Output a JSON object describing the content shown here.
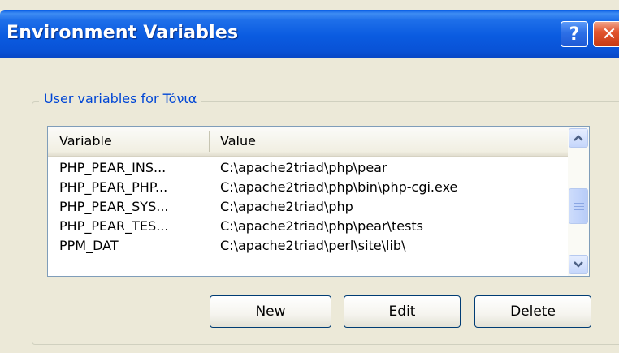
{
  "window": {
    "title": "Environment Variables",
    "help_label": "?",
    "close_label": "✕"
  },
  "user_variables": {
    "group_label": "User variables for Tóνια",
    "columns": [
      "Variable",
      "Value"
    ],
    "rows": [
      {
        "variable": "PHP_PEAR_INS...",
        "value": "C:\\apache2triad\\php\\pear"
      },
      {
        "variable": "PHP_PEAR_PHP...",
        "value": "C:\\apache2triad\\php\\bin\\php-cgi.exe"
      },
      {
        "variable": "PHP_PEAR_SYS...",
        "value": "C:\\apache2triad\\php"
      },
      {
        "variable": "PHP_PEAR_TES...",
        "value": "C:\\apache2triad\\php\\pear\\tests"
      },
      {
        "variable": "PPM_DAT",
        "value": "C:\\apache2triad\\perl\\site\\lib\\"
      }
    ],
    "buttons": {
      "new": "New",
      "edit": "Edit",
      "delete": "Delete"
    }
  },
  "scrollbar": {
    "up_icon": "scroll-up-arrow",
    "down_icon": "scroll-down-arrow"
  },
  "colors": {
    "titlebar": "#0a5be0",
    "group_label": "#0046d5",
    "dialog_bg": "#ece9d8"
  }
}
